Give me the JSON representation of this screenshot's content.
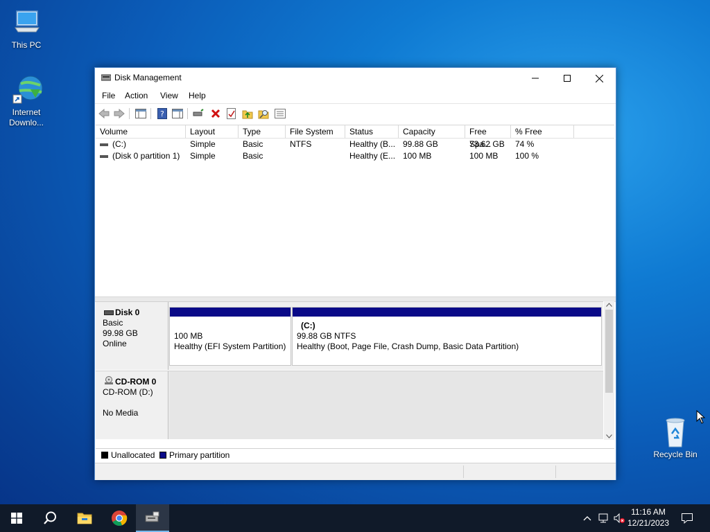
{
  "desktop": {
    "icons": [
      {
        "label": "This PC"
      },
      {
        "label": "Internet Downlo..."
      },
      {
        "label": "Recycle Bin"
      }
    ]
  },
  "window": {
    "title": "Disk Management",
    "menu": [
      "File",
      "Action",
      "View",
      "Help"
    ],
    "columns": [
      "Volume",
      "Layout",
      "Type",
      "File System",
      "Status",
      "Capacity",
      "Free Spa...",
      "% Free"
    ],
    "rows": [
      {
        "volume": "(C:)",
        "layout": "Simple",
        "type": "Basic",
        "fs": "NTFS",
        "status": "Healthy (B...",
        "capacity": "99.88 GB",
        "free": "73.62 GB",
        "pct": "74 %"
      },
      {
        "volume": "(Disk 0 partition 1)",
        "layout": "Simple",
        "type": "Basic",
        "fs": "",
        "status": "Healthy (E...",
        "capacity": "100 MB",
        "free": "100 MB",
        "pct": "100 %"
      }
    ],
    "disks": [
      {
        "name": "Disk 0",
        "type": "Basic",
        "size": "99.98 GB",
        "state": "Online",
        "partitions": [
          {
            "name": "",
            "size": "100 MB",
            "status": "Healthy (EFI System Partition)"
          },
          {
            "name": "(C:)",
            "size": "99.88 GB NTFS",
            "status": "Healthy (Boot, Page File, Crash Dump, Basic Data Partition)"
          }
        ]
      },
      {
        "name": "CD-ROM 0",
        "type": "CD-ROM (D:)",
        "state": "No Media"
      }
    ],
    "legend": [
      "Unallocated",
      "Primary partition"
    ],
    "colors": {
      "primary_partition": "#0a0a88",
      "unallocated": "#000000"
    }
  },
  "taskbar": {
    "time": "11:16 AM",
    "date": "12/21/2023"
  }
}
